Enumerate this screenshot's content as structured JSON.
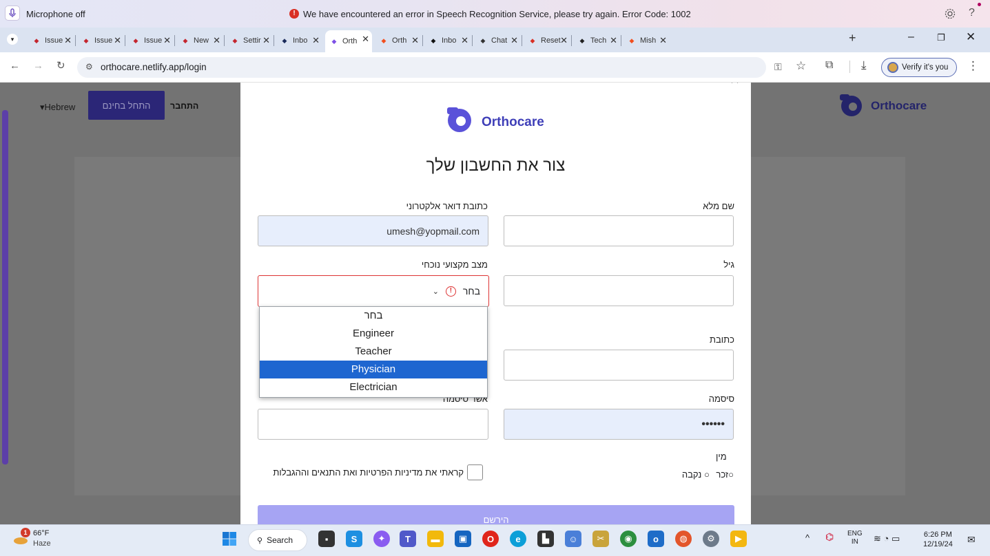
{
  "notification": {
    "mic_label": "Microphone off",
    "error_text": "We have encountered an error in Speech Recognition Service, please try again. Error Code: 1002",
    "settings_icon": "gear-icon",
    "help_label": "?"
  },
  "tabs": [
    {
      "label": "Issue",
      "icon": "ruby-icon",
      "color": "#c4262e"
    },
    {
      "label": "Issue",
      "icon": "ruby-icon",
      "color": "#c4262e"
    },
    {
      "label": "Issue",
      "icon": "ruby-icon",
      "color": "#c4262e"
    },
    {
      "label": "New",
      "icon": "ruby-icon",
      "color": "#c4262e"
    },
    {
      "label": "Settir",
      "icon": "ruby-icon",
      "color": "#c4262e"
    },
    {
      "label": "Inbo",
      "icon": "yopmail-icon",
      "color": "#1a2a5a"
    },
    {
      "label": "Orth",
      "icon": "vite-icon",
      "color": "#7d50e6"
    },
    {
      "label": "Orth",
      "icon": "figma-icon",
      "color": "#f24e1e"
    },
    {
      "label": "Inbo",
      "icon": "mail-icon",
      "color": "#111111"
    },
    {
      "label": "Chat",
      "icon": "openai-icon",
      "color": "#333333"
    },
    {
      "label": "Reset",
      "icon": "gmail-icon",
      "color": "#d93025"
    },
    {
      "label": "Tech",
      "icon": "techstack-icon",
      "color": "#222222"
    },
    {
      "label": "Mish",
      "icon": "figma-icon",
      "color": "#f24e1e"
    }
  ],
  "active_tab_index": 6,
  "window_controls": {
    "minimize": "–",
    "maximize": "❐",
    "close": "✕",
    "new_tab": "+"
  },
  "address_bar": {
    "url": "orthocare.netlify.app/login",
    "verify_label": "Verify it's you"
  },
  "background_page": {
    "lang_label": "▾Hebrew",
    "start_free_label": "התחל בחינם",
    "login_label": "התחבר",
    "brand": "Orthocare"
  },
  "modal": {
    "brand": "Orthocare",
    "title": "צור את החשבון שלך",
    "fields": {
      "full_name_label": "שם מלא",
      "full_name_value": "",
      "email_label": "כתובת דואר אלקטרוני",
      "email_value": "umesh@yopmail.com",
      "age_label": "גיל",
      "age_value": "",
      "profession_label": "מצב מקצועי נוכחי",
      "profession_value": "בחר",
      "address_label": "כתובת",
      "address_value": "",
      "password_label": "סיסמה",
      "password_value": "••••••",
      "confirm_password_label": "אשר סיסמה",
      "confirm_password_value": ""
    },
    "profession_options": [
      "בחר",
      "Engineer",
      "Teacher",
      "Physician",
      "Electrician"
    ],
    "highlighted_option": "Physician",
    "gender_label": "מין",
    "gender_options": {
      "male": "זכר",
      "female": "נקבה"
    },
    "terms_label": "קראתי את מדיניות הפרטיות ואת התנאים וההגבלות",
    "submit_label": "הירשם"
  },
  "taskbar": {
    "temperature": "66°F",
    "weather": "Haze",
    "weather_badge": "1",
    "search_label": "Search",
    "lang_top": "ENG",
    "lang_bottom": "IN",
    "time": "6:26 PM",
    "date": "12/19/24"
  }
}
